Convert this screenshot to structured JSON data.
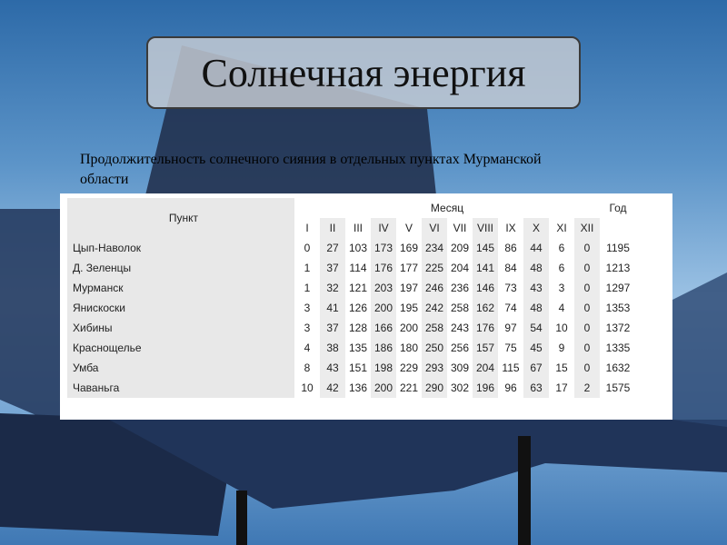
{
  "title": "Солнечная энергия",
  "subtitle": "Продолжительность солнечного сияния в отдельных пунктах Мурманской области",
  "table": {
    "col_place": "Пункт",
    "col_month": "Месяц",
    "col_year": "Год",
    "months": [
      "I",
      "II",
      "III",
      "IV",
      "V",
      "VI",
      "VII",
      "VIII",
      "IX",
      "X",
      "XI",
      "XII"
    ],
    "rows": [
      {
        "name": "Цып-Наволок",
        "values": [
          "0",
          "27",
          "103",
          "173",
          "169",
          "234",
          "209",
          "145",
          "86",
          "44",
          "6",
          "0"
        ],
        "year": "1195"
      },
      {
        "name": "Д. Зеленцы",
        "values": [
          "1",
          "37",
          "114",
          "176",
          "177",
          "225",
          "204",
          "141",
          "84",
          "48",
          "6",
          "0"
        ],
        "year": "1213"
      },
      {
        "name": "Мурманск",
        "values": [
          "1",
          "32",
          "121",
          "203",
          "197",
          "246",
          "236",
          "146",
          "73",
          "43",
          "3",
          "0"
        ],
        "year": "1297"
      },
      {
        "name": "Янискоски",
        "values": [
          "3",
          "41",
          "126",
          "200",
          "195",
          "242",
          "258",
          "162",
          "74",
          "48",
          "4",
          "0"
        ],
        "year": "1353"
      },
      {
        "name": "Хибины",
        "values": [
          "3",
          "37",
          "128",
          "166",
          "200",
          "258",
          "243",
          "176",
          "97",
          "54",
          "10",
          "0"
        ],
        "year": "1372"
      },
      {
        "name": "Краснощелье",
        "values": [
          "4",
          "38",
          "135",
          "186",
          "180",
          "250",
          "256",
          "157",
          "75",
          "45",
          "9",
          "0"
        ],
        "year": "1335"
      },
      {
        "name": "Умба",
        "values": [
          "8",
          "43",
          "151",
          "198",
          "229",
          "293",
          "309",
          "204",
          "115",
          "67",
          "15",
          "0"
        ],
        "year": "1632"
      },
      {
        "name": "Чаваньга",
        "values": [
          "10",
          "42",
          "136",
          "200",
          "221",
          "290",
          "302",
          "196",
          "96",
          "63",
          "17",
          "2"
        ],
        "year": "1575"
      }
    ]
  }
}
